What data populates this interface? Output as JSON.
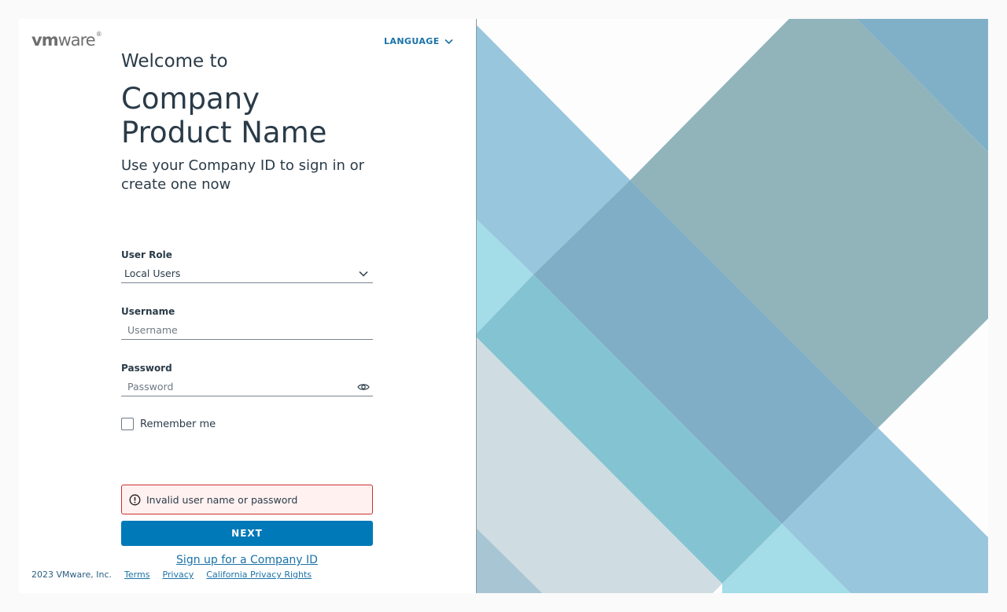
{
  "brand": {
    "logo_vm": "vm",
    "logo_ware": "ware",
    "logo_tm": "®"
  },
  "header": {
    "language_label": "LANGUAGE"
  },
  "heading": {
    "welcome": "Welcome to",
    "product_line1": "Company",
    "product_line2": "Product Name",
    "subtitle": "Use your Company ID to sign in or create one now"
  },
  "form": {
    "user_role": {
      "label": "User Role",
      "value": "Local Users"
    },
    "username": {
      "label": "Username",
      "placeholder": "Username"
    },
    "password": {
      "label": "Password",
      "placeholder": "Password"
    },
    "remember_label": "Remember me",
    "error_text": "Invalid user name or password",
    "next_label": "NEXT",
    "signup_label": "Sign up for a Company ID"
  },
  "footer": {
    "copyright": "2023 VMware, Inc.",
    "links": [
      "Terms",
      "Privacy",
      "California Privacy Rights"
    ]
  },
  "colors": {
    "accent": "#0079b8",
    "error_border": "#c9302c",
    "error_bg": "#fff1f0"
  }
}
